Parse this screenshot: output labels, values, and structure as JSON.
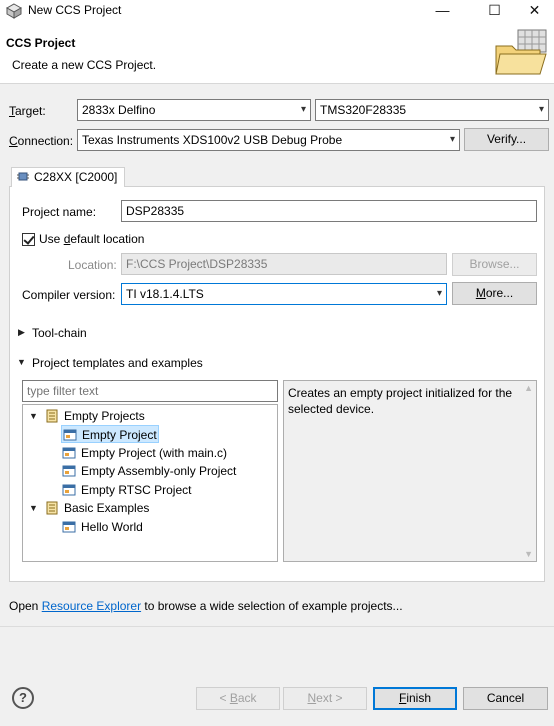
{
  "window": {
    "title": "New CCS Project",
    "minimize": "—",
    "maximize": "☐",
    "close": "✕"
  },
  "banner": {
    "title": "CCS Project",
    "subtitle": "Create a new CCS Project."
  },
  "target": {
    "label": "Target:",
    "family": "2833x Delfino",
    "device": "TMS320F28335"
  },
  "connection": {
    "label": "Connection:",
    "value": "Texas Instruments XDS100v2 USB Debug Probe",
    "verify_label": "Verify..."
  },
  "tab": {
    "label": "C28XX [C2000]"
  },
  "project": {
    "name_label": "Project name:",
    "name_value": "DSP28335",
    "default_location_label": "Use default location",
    "location_label": "Location:",
    "location_value": "F:\\CCS Project\\DSP28335",
    "browse_label": "Browse...",
    "compiler_label": "Compiler version:",
    "compiler_value": "TI v18.1.4.LTS",
    "more_label": "More..."
  },
  "sections": {
    "toolchain": "Tool-chain",
    "templates": "Project templates and examples"
  },
  "filter": {
    "placeholder": "type filter text"
  },
  "tree": {
    "group1": "Empty Projects",
    "items1": [
      "Empty Project",
      "Empty Project (with main.c)",
      "Empty Assembly-only Project",
      "Empty RTSC Project"
    ],
    "group2": "Basic Examples",
    "items2": [
      "Hello World"
    ]
  },
  "description": "Creates an empty project initialized for the selected device.",
  "footer_text": {
    "prefix": "Open ",
    "link": "Resource Explorer",
    "suffix": " to browse a wide selection of example projects..."
  },
  "buttons": {
    "help": "?",
    "back": "< Back",
    "next": "Next >",
    "finish": "Finish",
    "cancel": "Cancel"
  }
}
